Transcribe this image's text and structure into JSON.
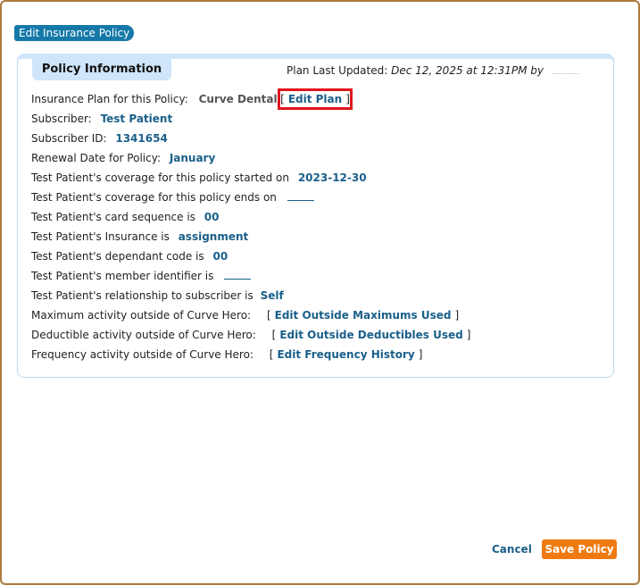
{
  "dialog": {
    "title": "Edit Insurance Policy"
  },
  "panel": {
    "tab_label": "Policy Information",
    "last_updated_label": "Plan Last Updated:",
    "last_updated_value": "Dec 12, 2025 at 12:31PM by"
  },
  "fields": {
    "plan_label": "Insurance Plan for this Policy:",
    "plan_value": "Curve Dental",
    "edit_plan_open": "[",
    "edit_plan_link": "Edit Plan",
    "edit_plan_close": "]",
    "subscriber_label": "Subscriber:",
    "subscriber_value": "Test Patient",
    "subscriber_id_label": "Subscriber ID:",
    "subscriber_id_value": "1341654",
    "renewal_label": "Renewal Date for Policy:",
    "renewal_value": "January",
    "coverage_start_label": "Test Patient's coverage for this policy started on",
    "coverage_start_value": "2023-12-30",
    "coverage_end_label": "Test Patient's coverage for this policy ends on",
    "card_seq_label": "Test Patient's card sequence is",
    "card_seq_value": "00",
    "insurance_label": "Test Patient's Insurance is",
    "insurance_value": "assignment",
    "dependant_label": "Test Patient's dependant code is",
    "dependant_value": "00",
    "member_label": "Test Patient's member identifier is",
    "relationship_label": "Test Patient's relationship to subscriber is",
    "relationship_value": "Self",
    "max_label": "Maximum activity outside of Curve Hero:",
    "max_link": "Edit Outside Maximums Used",
    "deduct_label": "Deductible activity outside of Curve Hero:",
    "deduct_link": "Edit Outside Deductibles Used",
    "freq_label": "Frequency activity outside of Curve Hero:",
    "freq_link": "Edit Frequency History",
    "bracket_open": "[",
    "bracket_close": "]"
  },
  "footer": {
    "cancel_label": "Cancel",
    "save_label": "Save Policy"
  },
  "colors": {
    "accent": "#1479a8",
    "link": "#1a5f8a",
    "save_button": "#ef7a10",
    "highlight_box": "#e0141e",
    "panel_header": "#cfe6fa"
  }
}
